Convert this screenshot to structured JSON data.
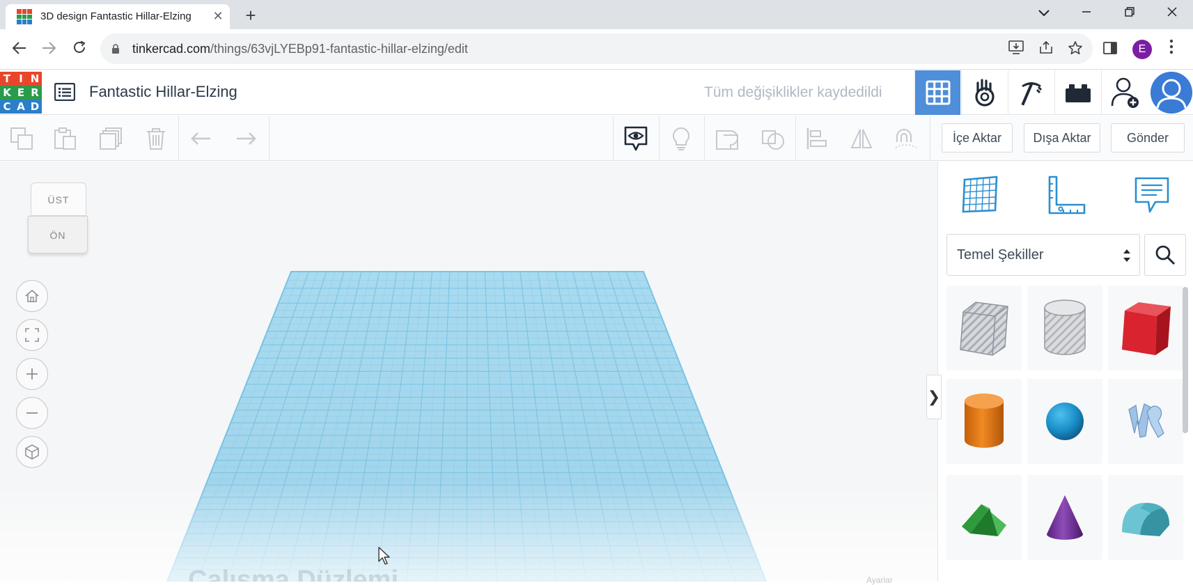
{
  "browser": {
    "tab_title": "3D design Fantastic Hillar-Elzing",
    "tab_close": "✕",
    "new_tab": "+",
    "url_host": "tinkercad.com",
    "url_path": "/things/63vjLYEBp91-fantastic-hillar-elzing/edit",
    "profile_initial": "E",
    "window_controls": {
      "dropdown": "⌄",
      "minimize": "—",
      "restore": "❐",
      "close": "✕"
    }
  },
  "header": {
    "logo_letters": [
      "T",
      "I",
      "N",
      "K",
      "E",
      "R",
      "C",
      "A",
      "D"
    ],
    "logo_colors": [
      "#e8452b",
      "#e8452b",
      "#e8452b",
      "#2a9b4b",
      "#2a9b4b",
      "#2a9b4b",
      "#2a7fc8",
      "#2a7fc8",
      "#2a7fc8"
    ],
    "design_title": "Fantastic Hillar-Elzing",
    "save_status": "Tüm değişiklikler kaydedildi",
    "active_view_color": "#4f8ed8"
  },
  "toolbar": {
    "import_label": "İçe Aktar",
    "export_label": "Dışa Aktar",
    "send_label": "Gönder"
  },
  "viewport": {
    "viewcube_top": "ÜST",
    "viewcube_front": "ÖN",
    "grid_color": "#7ac3e3",
    "ghost_label": "Çalışma Düzlemi",
    "ghost_small": "Ayarlar"
  },
  "panel": {
    "category_label": "Temel Şekiller",
    "collapse_glyph": "❯",
    "shapes": [
      {
        "name": "Kutu (delik)",
        "color": "#b8bcc2"
      },
      {
        "name": "Silindir (delik)",
        "color": "#c4c7cb"
      },
      {
        "name": "Kutu",
        "color": "#d9232e"
      },
      {
        "name": "Silindir",
        "color": "#e57b17"
      },
      {
        "name": "Küre",
        "color": "#1b8fc9"
      },
      {
        "name": "Metin",
        "color": "#9fc2e6"
      },
      {
        "name": "Çatı",
        "color": "#2f9a3c"
      },
      {
        "name": "Koni",
        "color": "#7a3aa0"
      },
      {
        "name": "Yuvarlak Çatı",
        "color": "#4fb0bf"
      }
    ]
  }
}
